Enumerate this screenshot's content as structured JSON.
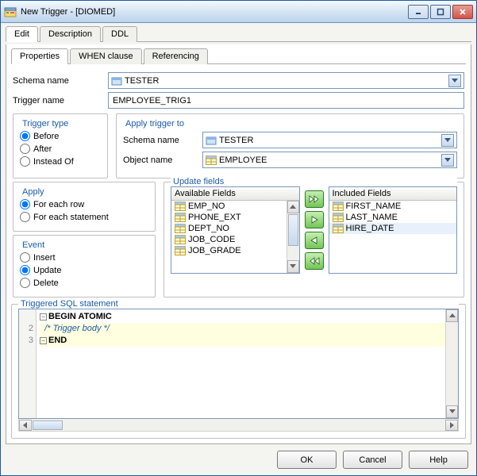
{
  "window": {
    "title": "New Trigger - [DIOMED]"
  },
  "topTabs": {
    "edit": "Edit",
    "description": "Description",
    "ddl": "DDL"
  },
  "subTabs": {
    "properties": "Properties",
    "when": "WHEN clause",
    "referencing": "Referencing"
  },
  "labels": {
    "schemaName": "Schema name",
    "triggerName": "Trigger name",
    "triggerType": "Trigger type",
    "before": "Before",
    "after": "After",
    "insteadOf": "Instead Of",
    "applyTriggerTo": "Apply trigger to",
    "objectName": "Object name",
    "apply": "Apply",
    "forEachRow": "For each row",
    "forEachStatement": "For each statement",
    "event": "Event",
    "insert": "Insert",
    "update": "Update",
    "delete": "Delete",
    "updateFields": "Update fields",
    "availableFields": "Available Fields",
    "includedFields": "Included Fields",
    "triggeredSql": "Triggered SQL statement"
  },
  "form": {
    "schema": "TESTER",
    "triggerName": "EMPLOYEE_TRIG1",
    "applySchema": "TESTER",
    "objectName": "EMPLOYEE"
  },
  "availableFields": [
    "EMP_NO",
    "PHONE_EXT",
    "DEPT_NO",
    "JOB_CODE",
    "JOB_GRADE"
  ],
  "includedFields": [
    "FIRST_NAME",
    "LAST_NAME",
    "HIRE_DATE"
  ],
  "sql": {
    "line1": "BEGIN ATOMIC",
    "line2": "  /* Trigger body */",
    "line3": "END"
  },
  "buttons": {
    "ok": "OK",
    "cancel": "Cancel",
    "help": "Help"
  }
}
